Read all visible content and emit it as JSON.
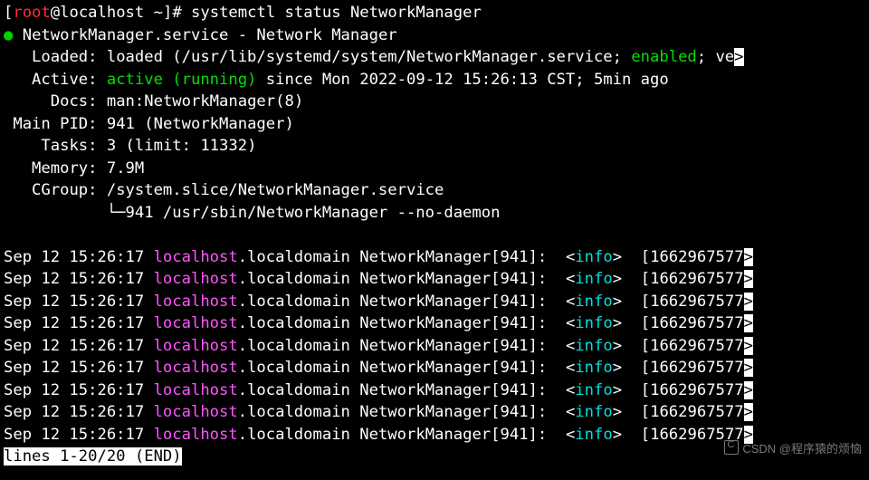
{
  "prompt": {
    "user": "root",
    "host": "localhost",
    "cwd": "~",
    "cmd": "systemctl status NetworkManager"
  },
  "status": {
    "bullet": "●",
    "unit": "NetworkManager.service",
    "desc": "Network Manager",
    "loaded": {
      "label": "Loaded:",
      "value_pre": "loaded (/usr/lib/systemd/system/NetworkManager.service; ",
      "enabled": "enabled",
      "value_post": "; ve",
      "trunc": ">"
    },
    "active": {
      "label": "Active:",
      "state": "active (running)",
      "since": " since Mon 2022-09-12 15:26:13 CST; 5min ago"
    },
    "docs": {
      "label": "Docs:",
      "value": "man:NetworkManager(8)"
    },
    "mainpid": {
      "label": "Main PID:",
      "value": "941 (NetworkManager)"
    },
    "tasks": {
      "label": "Tasks:",
      "value": "3 (limit: 11332)"
    },
    "memory": {
      "label": "Memory:",
      "value": "7.9M"
    },
    "cgroup": {
      "label": "CGroup:",
      "value": "/system.slice/NetworkManager.service"
    },
    "cgroup_child": {
      "tree": "└─",
      "text": "941 /usr/sbin/NetworkManager --no-daemon"
    }
  },
  "log": {
    "ts": "Sep 12 15:26:17",
    "host": "localhost",
    "domain": ".localdomain",
    "proc": "NetworkManager[941]:",
    "tag_open": "<",
    "tag": "info",
    "tag_close": ">",
    "epoch": "[1662967577",
    "trunc": ">"
  },
  "pager": "lines 1-20/20 (END)",
  "watermark": "CSDN @程序猿的烦恼"
}
